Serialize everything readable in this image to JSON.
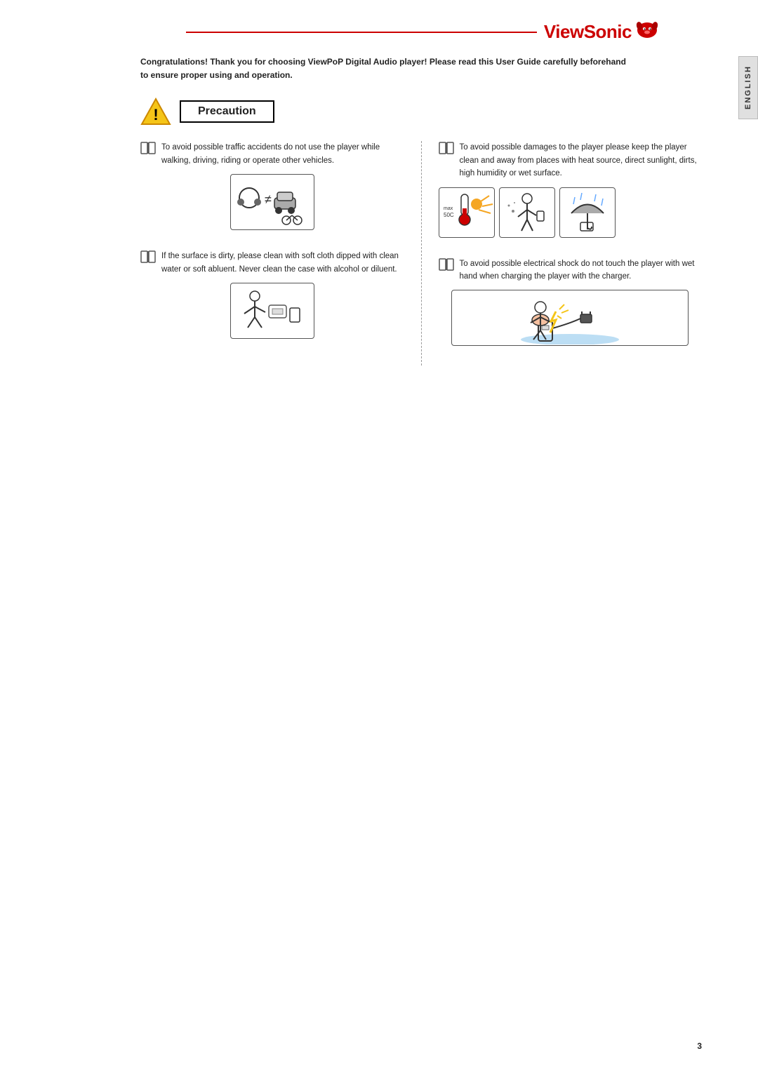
{
  "logo": {
    "text": "ViewSonic",
    "icon_label": "viewsonic-logo-icon"
  },
  "intro": {
    "text": "Congratulations! Thank you for choosing ViewPoP Digital Audio player! Please read this User Guide carefully beforehand to ensure proper using and operation."
  },
  "sidebar": {
    "label": "ENGLISH"
  },
  "precaution": {
    "title": "Precaution"
  },
  "items": [
    {
      "id": "item-traffic",
      "text": "To avoid possible traffic accidents do not use the player while walking, driving, riding or operate other vehicles.",
      "side": "left"
    },
    {
      "id": "item-dirty",
      "text": "If the surface is dirty, please clean with soft cloth dipped with clean water or soft abluent. Never clean the case with alcohol or diluent.",
      "side": "left"
    },
    {
      "id": "item-damage",
      "text": "To avoid possible damages to the player please keep the player clean and away from places with heat source, direct sunlight, dirts, high humidity or wet surface.",
      "side": "right"
    },
    {
      "id": "item-electrical",
      "text": "To avoid possible electrical shock do not touch the player with wet hand when charging the player with the charger.",
      "side": "right"
    }
  ],
  "page_number": "3"
}
